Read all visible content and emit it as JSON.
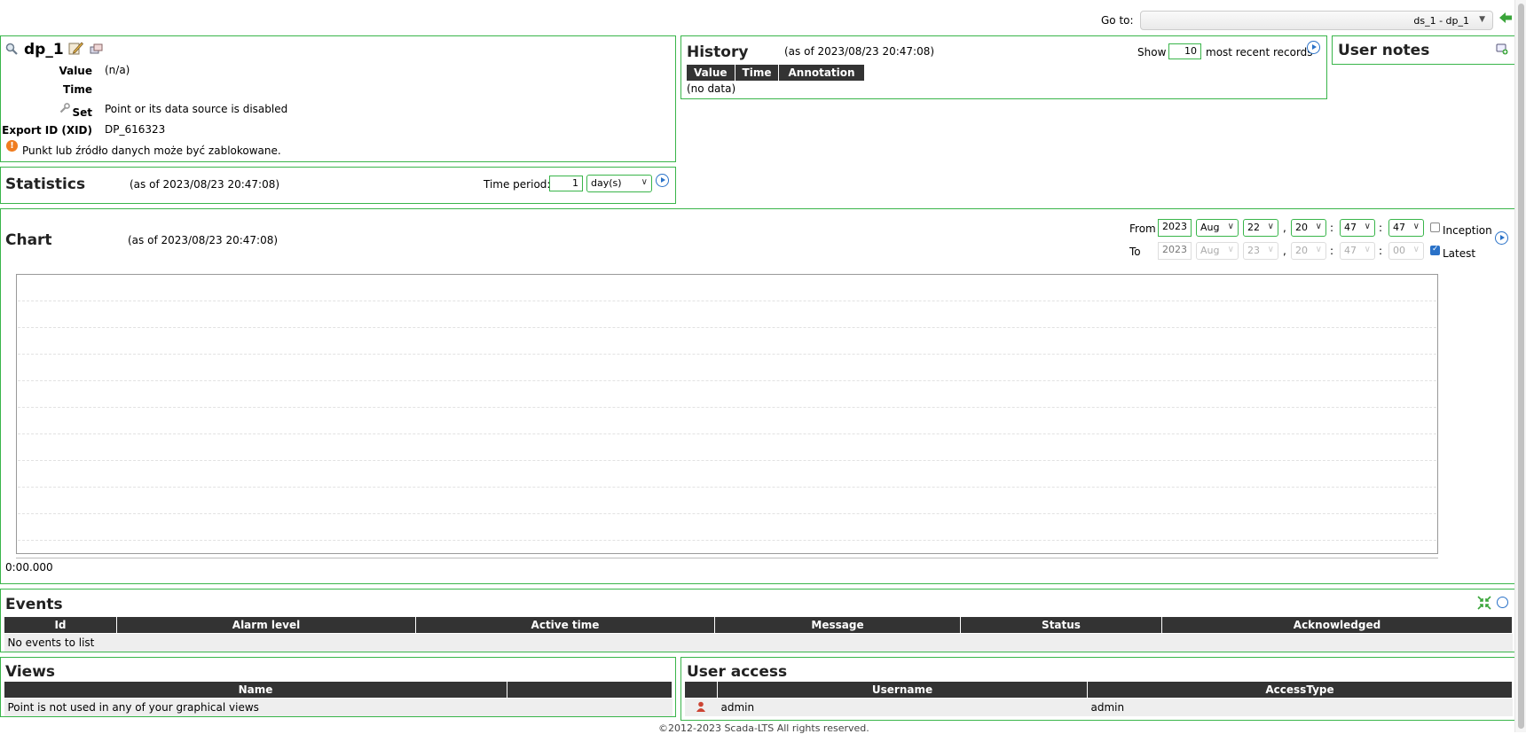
{
  "goto": {
    "label": "Go to:",
    "selected": "ds_1 - dp_1"
  },
  "point": {
    "name": "dp_1",
    "value_label": "Value",
    "value": "(n/a)",
    "time_label": "Time",
    "time": "",
    "set_label": "Set",
    "set_value": "Point or its data source is disabled",
    "xid_label": "Export ID (XID)",
    "xid": "DP_616323",
    "warning": "Punkt lub źródło danych może być zablokowane."
  },
  "history": {
    "title": "History",
    "as_of": "(as of 2023/08/23 20:47:08)",
    "show_label": "Show",
    "count": "10",
    "recent_label": "most recent records",
    "columns": [
      "Value",
      "Time",
      "Annotation"
    ],
    "empty": "(no data)"
  },
  "user_notes": {
    "title": "User notes"
  },
  "statistics": {
    "title": "Statistics",
    "as_of": "(as of 2023/08/23 20:47:08)",
    "period_label": "Time period:",
    "period_value": "1",
    "period_unit": "day(s)"
  },
  "chart": {
    "title": "Chart",
    "as_of": "(as of 2023/08/23 20:47:08)",
    "from_label": "From",
    "to_label": "To",
    "from": {
      "year": "2023",
      "month": "Aug",
      "day": "22",
      "hour": "20",
      "minute": "47",
      "second": "47"
    },
    "to": {
      "year": "2023",
      "month": "Aug",
      "day": "23",
      "hour": "20",
      "minute": "47",
      "second": "00"
    },
    "inception_label": "Inception",
    "latest_label": "Latest",
    "comma": ",",
    "colon": ":",
    "x_tick": "0:00.000"
  },
  "events": {
    "title": "Events",
    "columns": [
      "Id",
      "Alarm level",
      "Active time",
      "Message",
      "Status",
      "Acknowledged"
    ],
    "empty": "No events to list"
  },
  "views": {
    "title": "Views",
    "columns": [
      "Name",
      ""
    ],
    "empty": "Point is not used in any of your graphical views"
  },
  "user_access": {
    "title": "User access",
    "columns": [
      "",
      "Username",
      "AccessType"
    ],
    "rows": [
      {
        "username": "admin",
        "access": "admin"
      }
    ]
  },
  "footer": "©2012-2023 Scada-LTS All rights reserved.",
  "colors": {
    "accent": "#39b54a",
    "header_bg": "#333333",
    "link": "#2a72c8",
    "warn": "#f07c1f"
  }
}
